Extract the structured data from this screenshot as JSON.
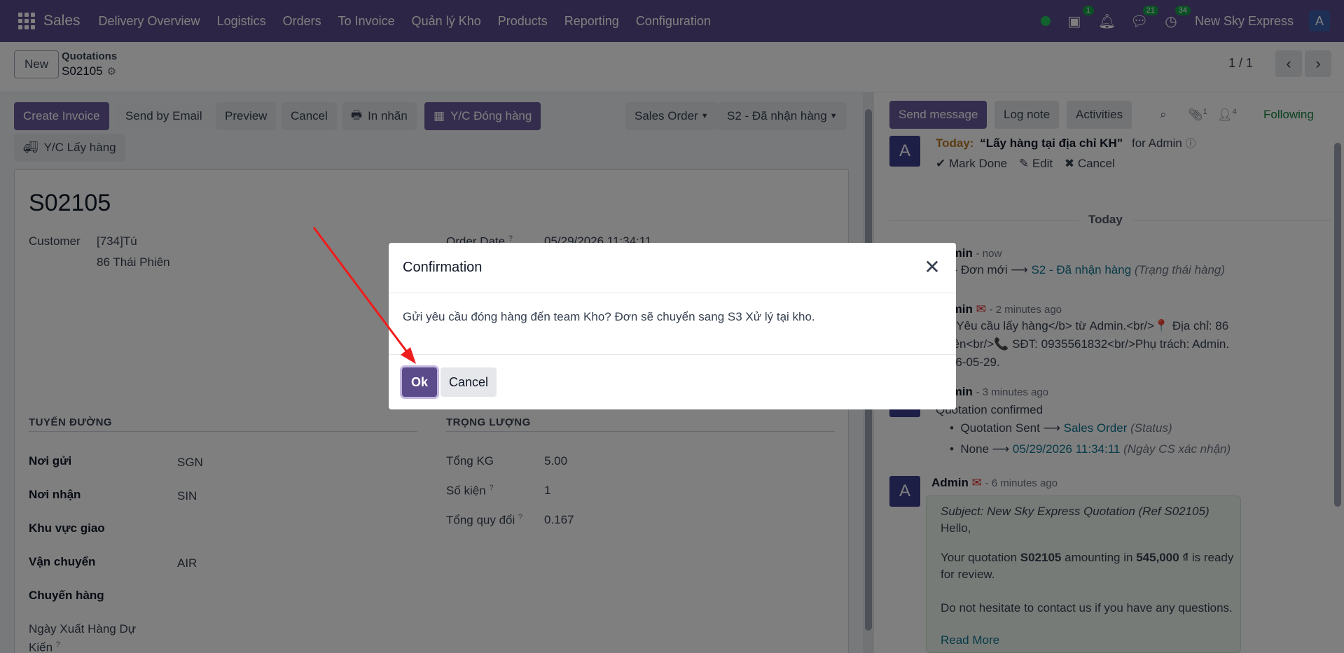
{
  "navbar": {
    "brand": "Sales",
    "menu": [
      "Delivery Overview",
      "Logistics",
      "Orders",
      "To Invoice",
      "Quản lý Kho",
      "Products",
      "Reporting",
      "Configuration"
    ],
    "activity_badge": "1",
    "chat_badge": "21",
    "clock_badge": "34",
    "company": "New Sky Express",
    "avatar_letter": "A"
  },
  "control": {
    "new_label": "New",
    "breadcrumb_parent": "Quotations",
    "breadcrumb_current": "S02105",
    "pager": "1 / 1"
  },
  "statusbar": {
    "buttons": [
      "Create Invoice",
      "Send by Email",
      "Preview",
      "Cancel",
      "In nhãn",
      "Y/C Đóng hàng"
    ],
    "second_row": "Y/C Lấy hàng",
    "sales_order": "Sales Order",
    "stage": "S2 - Đã nhận hàng"
  },
  "form": {
    "title": "S02105",
    "customer_label": "Customer",
    "customer_line1": "[734]Tú",
    "customer_line2": "86 Thái Phiên",
    "order_date_label": "Order Date",
    "order_date_value": "05/29/2026 11:34:11",
    "section_route": "TUYẾN ĐƯỜNG",
    "section_weight": "TRỌNG LƯỢNG",
    "noi_gui_label": "Nơi gửi",
    "noi_gui_value": "SGN",
    "noi_nhan_label": "Nơi nhận",
    "noi_nhan_value": "SIN",
    "khu_vuc_label": "Khu vực giao",
    "van_chuyen_label": "Vận chuyển",
    "van_chuyen_value": "AIR",
    "chuyen_hang_label": "Chuyến hàng",
    "ngay_xuat_label_1": "Ngày Xuất Hàng Dự",
    "ngay_xuat_label_2": "Kiến",
    "tong_kg_label": "Tổng KG",
    "tong_kg_value": "5.00",
    "so_kien_label": "Số kiện",
    "so_kien_value": "1",
    "tong_quy_doi_label": "Tổng quy đổi",
    "tong_quy_doi_value": "0.167"
  },
  "chatter": {
    "send_message": "Send message",
    "log_note": "Log note",
    "activities": "Activities",
    "attach_count": "1",
    "follower_count": "4",
    "following": "Following",
    "activity_today": "Today:",
    "activity_title": "“Lấy hàng tại địa chỉ KH”",
    "activity_for": "for Admin",
    "mark_done": "Mark Done",
    "edit": "Edit",
    "cancel": "Cancel",
    "day_separator": "Today",
    "msg1_time": "- now",
    "msg1_old": "S1 - Đơn mới",
    "msg1_new": "S2 - Đã nhận hàng",
    "msg1_field": "(Trạng thái hàng)",
    "msg2_time": "- 2 minutes ago",
    "msg2_line1": "<b>Yêu cầu lấy hàng</b> từ Admin.<br/>📍 Địa chỉ: 86",
    "msg2_line2": "Phiên<br/>📞 SĐT: 0935561832<br/>Phụ trách: Admin.",
    "msg2_line3": "2026-05-29.",
    "msg3_time": "- 3 minutes ago",
    "msg3_title": "Quotation confirmed",
    "msg3_b1_old": "Quotation Sent",
    "msg3_b1_new": "Sales Order",
    "msg3_b1_field": "(Status)",
    "msg3_b2_old": "None",
    "msg3_b2_new": "05/29/2026 11:34:11",
    "msg3_b2_field": "(Ngày CS xác nhận)",
    "msg4_author": "Admin",
    "msg4_time": "- 6 minutes ago",
    "msg4_subject": "Subject: New Sky Express Quotation (Ref S02105)",
    "msg4_hello": "Hello,",
    "msg4_p1_a": "Your quotation",
    "msg4_p1_ref": "S02105",
    "msg4_p1_b": "amounting in",
    "msg4_p1_amount": "545,000 ₫",
    "msg4_p1_c": "is ready",
    "msg4_p1_d": "for review.",
    "msg4_p2": "Do not hesitate to contact us if you have any questions.",
    "msg4_more": "Read More"
  },
  "modal": {
    "title": "Confirmation",
    "body": "Gửi yêu cầu đóng hàng đến team Kho? Đơn sẽ chuyển sang S3 Xử lý tại kho.",
    "ok": "Ok",
    "cancel": "Cancel"
  },
  "colors": {
    "navbar": "#5b4b8a",
    "primary": "#6a5a9c",
    "annotation_arrow": "#ef1c1c"
  }
}
